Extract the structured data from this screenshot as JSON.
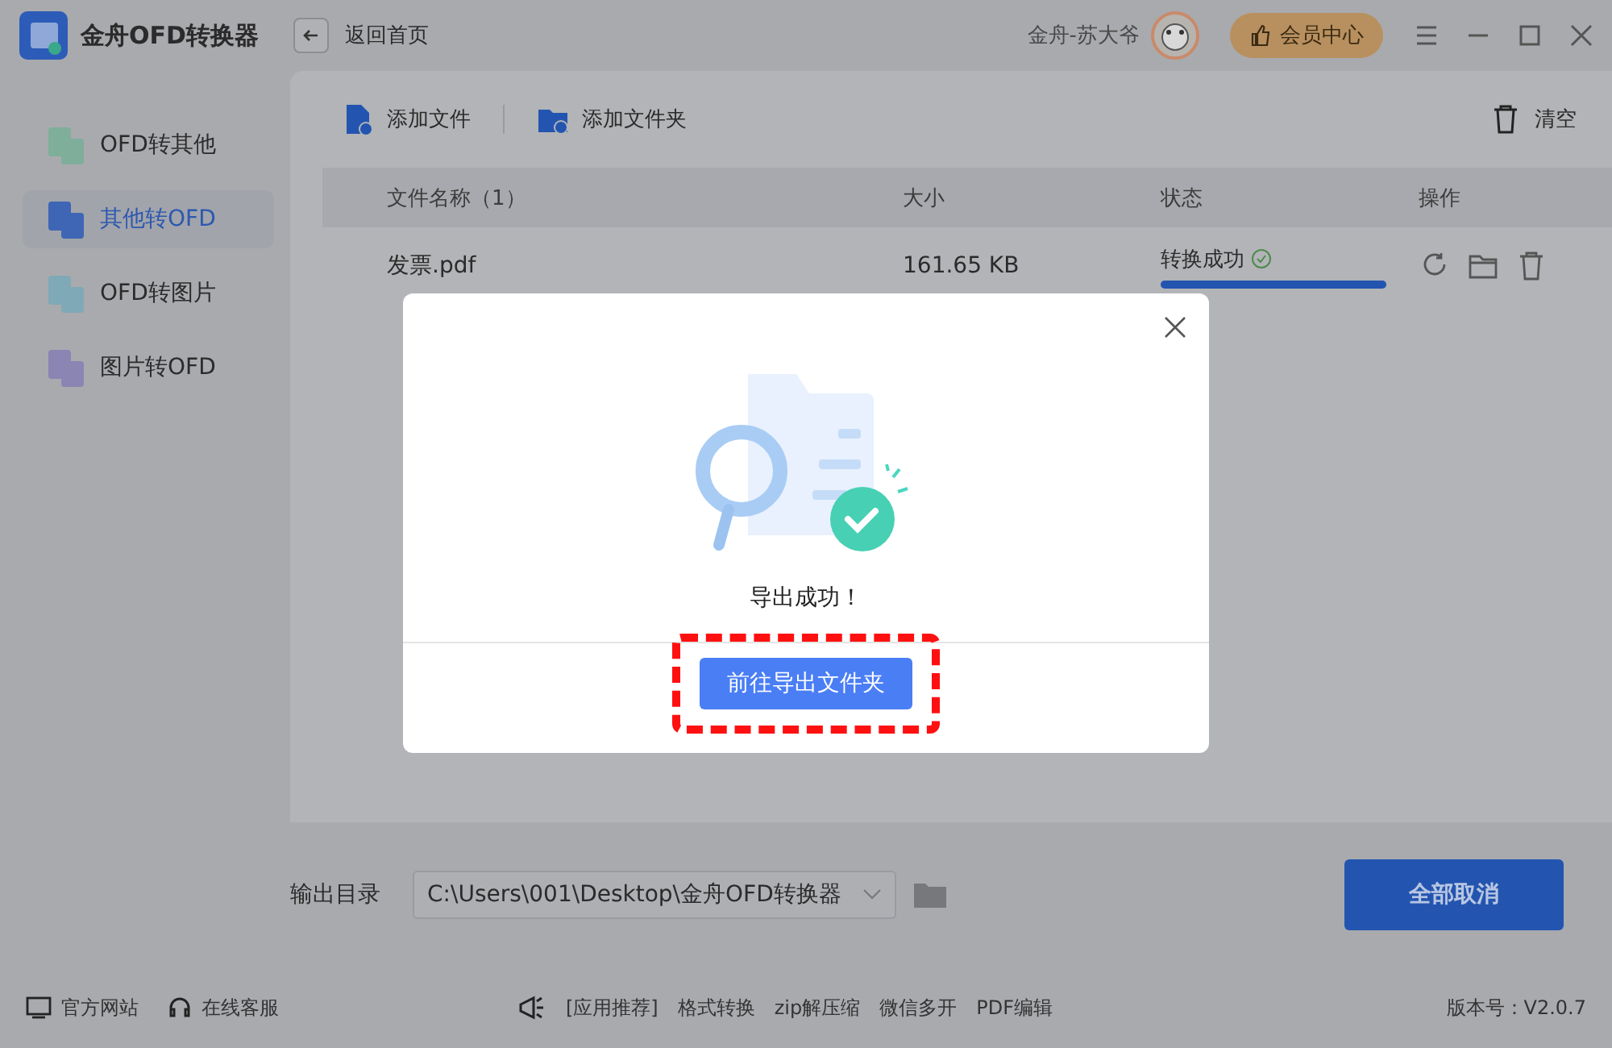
{
  "app": {
    "title": "金舟OFD转换器"
  },
  "header": {
    "back_label": "返回首页",
    "user_name": "金舟-苏大爷",
    "member_button": "会员中心"
  },
  "sidebar": {
    "items": [
      {
        "label": "OFD转其他",
        "selected": false,
        "color": "#7fae9a"
      },
      {
        "label": "其他转OFD",
        "selected": true,
        "color": "#3f66b5"
      },
      {
        "label": "OFD转图片",
        "selected": false,
        "color": "#7fa9b6"
      },
      {
        "label": "图片转OFD",
        "selected": false,
        "color": "#8a85b3"
      }
    ]
  },
  "toolbar": {
    "add_file": "添加文件",
    "add_folder": "添加文件夹",
    "clear": "清空"
  },
  "table": {
    "columns": [
      "文件名称（1）",
      "大小",
      "状态",
      "操作"
    ],
    "rows": [
      {
        "name": "发票.pdf",
        "size": "161.65 KB",
        "status": "转换成功",
        "level": 1
      }
    ]
  },
  "output": {
    "label": "输出目录",
    "path": "C:\\Users\\001\\Desktop\\金舟OFD转换器",
    "cancel_all": "全部取消"
  },
  "footer": {
    "links": [
      "官方网站",
      "在线客服"
    ],
    "promo": [
      "[应用推荐]",
      "格式转换",
      "zip解压缩",
      "微信多开",
      "PDF编辑"
    ],
    "version": "版本号：V2.0.7"
  },
  "dialog": {
    "message": "导出成功！",
    "button": "前往导出文件夹"
  }
}
